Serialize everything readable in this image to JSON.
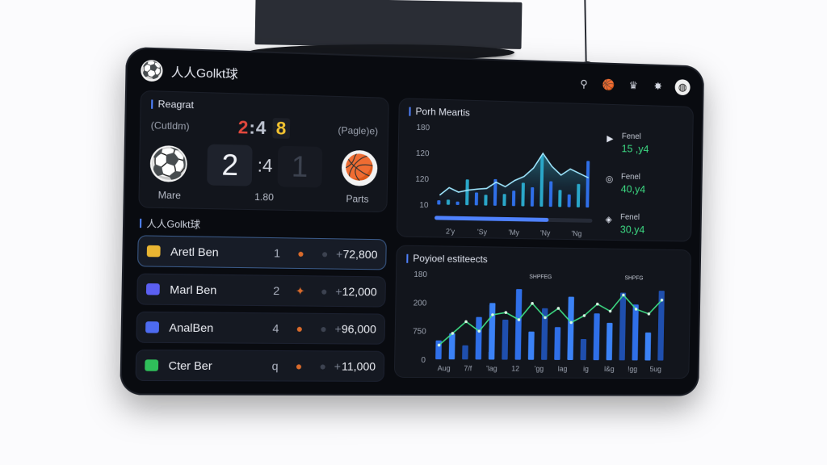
{
  "app": {
    "title": "人人Golkt球",
    "logo_icon": "⚽"
  },
  "top_icons": [
    {
      "name": "whistle-icon",
      "glyph": "⚲"
    },
    {
      "name": "basketball-icon",
      "glyph": "🏀"
    },
    {
      "name": "trophy-icon",
      "glyph": "♛"
    },
    {
      "name": "star-icon",
      "glyph": "✸"
    },
    {
      "name": "volleyball-icon",
      "glyph": "◍"
    }
  ],
  "score": {
    "title": "Reagrat",
    "left_tag": "(Cutldm)",
    "right_tag": "(Pagle)e)",
    "mini_a": "2",
    "mini_b": ":4",
    "mini_c": "8",
    "home_score": "2",
    "separator": ":4",
    "away_score": "1",
    "home_name": "Mare",
    "time": "1.80",
    "away_name": "Parts"
  },
  "list": {
    "title": "人人Golkt球",
    "items": [
      {
        "badge_color": "#e9b532",
        "name": "Aretl Ben",
        "rank": "1",
        "amount": "72,800"
      },
      {
        "badge_color": "#5b5ff2",
        "name": "Marl Ben",
        "rank": "2",
        "amount": "12,000"
      },
      {
        "badge_color": "#4d6bf0",
        "name": "AnalBen",
        "rank": "4",
        "amount": "96,000"
      },
      {
        "badge_color": "#2fbf5a",
        "name": "Cter Ber",
        "rank": "q",
        "amount": "11,000"
      }
    ]
  },
  "chart1": {
    "title": "Porh Meartis"
  },
  "chart2": {
    "title": "Poyioel estiteects"
  },
  "side_stats": [
    {
      "icon": "play-icon",
      "label": "Fenel",
      "value": "15 ,y4"
    },
    {
      "icon": "target-icon",
      "label": "Fenel",
      "value": "40,y4"
    },
    {
      "icon": "shield-icon",
      "label": "Fenel",
      "value": "30,y4"
    }
  ],
  "colors": {
    "accent": "#4f82ff",
    "positive": "#3ddc84",
    "panel": "#12151c"
  },
  "chart_data": [
    {
      "type": "bar",
      "title": "Porh Meartis",
      "y_ticks": [
        "180",
        "120",
        "120",
        "10"
      ],
      "x_ticks": [
        "2'y",
        "'Sy",
        "'My",
        "'Ny",
        "'Ng"
      ],
      "ylim": [
        0,
        180
      ],
      "values": [
        10,
        12,
        8,
        60,
        30,
        25,
        62,
        28,
        36,
        55,
        45,
        120,
        60,
        40,
        30,
        55,
        110
      ],
      "line": [
        22,
        40,
        30,
        35,
        38,
        40,
        55,
        45,
        60,
        70,
        90,
        125,
        95,
        75,
        90,
        80,
        70
      ],
      "progress": 0.72
    },
    {
      "type": "bar",
      "title": "Poyioel estiteects",
      "y_ticks": [
        "180",
        "200",
        "750",
        "0"
      ],
      "x_ticks": [
        "Aug",
        "7/f",
        "'lag",
        "12",
        "'gg",
        "lag",
        "ig",
        "l&g",
        "!gg",
        "5ug"
      ],
      "annotations": [
        "SHPFEG",
        "SHPFG"
      ],
      "ylim": [
        0,
        180
      ],
      "values": [
        40,
        55,
        30,
        90,
        120,
        85,
        150,
        60,
        110,
        70,
        135,
        45,
        100,
        80,
        145,
        120,
        60,
        150
      ],
      "line": [
        30,
        55,
        80,
        60,
        95,
        100,
        85,
        120,
        90,
        110,
        80,
        95,
        120,
        105,
        140,
        110,
        100,
        130
      ]
    }
  ]
}
